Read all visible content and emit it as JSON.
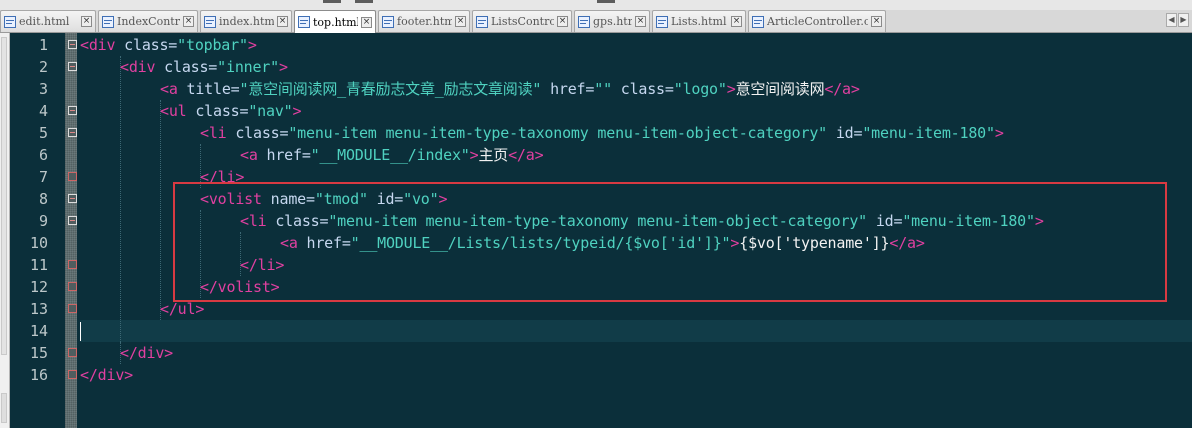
{
  "tabs": [
    {
      "label": "edit.html",
      "active": false
    },
    {
      "label": "IndexController.class.php",
      "active": false
    },
    {
      "label": "index.html",
      "active": false
    },
    {
      "label": "top.html",
      "active": true
    },
    {
      "label": "footer.html",
      "active": false
    },
    {
      "label": "ListsController.class.php",
      "active": false
    },
    {
      "label": "gps.html",
      "active": false
    },
    {
      "label": "Lists.html",
      "active": false
    },
    {
      "label": "ArticleController.class.php",
      "active": false
    }
  ],
  "tab_scroll": {
    "left": "◀",
    "right": "▶"
  },
  "close_glyph": "×",
  "line_numbers": [
    "1",
    "2",
    "3",
    "4",
    "5",
    "6",
    "7",
    "8",
    "9",
    "10",
    "11",
    "12",
    "13",
    "14",
    "15",
    "16"
  ],
  "code_lines": [
    [
      {
        "t": "tag",
        "v": "<div "
      },
      {
        "t": "attr",
        "v": "class="
      },
      {
        "t": "val",
        "v": "\"topbar\""
      },
      {
        "t": "tag",
        "v": ">"
      }
    ],
    [
      {
        "t": "tag",
        "v": "<div "
      },
      {
        "t": "attr",
        "v": "class="
      },
      {
        "t": "val",
        "v": "\"inner\""
      },
      {
        "t": "tag",
        "v": ">"
      }
    ],
    [
      {
        "t": "tag",
        "v": "<a "
      },
      {
        "t": "attr",
        "v": "title="
      },
      {
        "t": "val",
        "v": "\"意空间阅读网_青春励志文章_励志文章阅读\""
      },
      {
        "t": "attr",
        "v": " href="
      },
      {
        "t": "val",
        "v": "\"\""
      },
      {
        "t": "attr",
        "v": " class="
      },
      {
        "t": "val",
        "v": "\"logo\""
      },
      {
        "t": "tag",
        "v": ">"
      },
      {
        "t": "text",
        "v": "意空间阅读网"
      },
      {
        "t": "tag",
        "v": "</a>"
      }
    ],
    [
      {
        "t": "tag",
        "v": "<ul "
      },
      {
        "t": "attr",
        "v": "class="
      },
      {
        "t": "val",
        "v": "\"nav\""
      },
      {
        "t": "tag",
        "v": ">"
      }
    ],
    [
      {
        "t": "tag",
        "v": "<li "
      },
      {
        "t": "attr",
        "v": "class="
      },
      {
        "t": "val",
        "v": "\"menu-item menu-item-type-taxonomy menu-item-object-category\""
      },
      {
        "t": "attr",
        "v": " id="
      },
      {
        "t": "val",
        "v": "\"menu-item-180\""
      },
      {
        "t": "tag",
        "v": ">"
      }
    ],
    [
      {
        "t": "tag",
        "v": "<a "
      },
      {
        "t": "attr",
        "v": "href="
      },
      {
        "t": "val",
        "v": "\"__MODULE__/index\""
      },
      {
        "t": "tag",
        "v": ">"
      },
      {
        "t": "text",
        "v": "主页"
      },
      {
        "t": "tag",
        "v": "</a>"
      }
    ],
    [
      {
        "t": "tag",
        "v": "</li>"
      }
    ],
    [
      {
        "t": "tag",
        "v": "<volist "
      },
      {
        "t": "attr",
        "v": "name="
      },
      {
        "t": "val",
        "v": "\"tmod\""
      },
      {
        "t": "attr",
        "v": " id="
      },
      {
        "t": "val",
        "v": "\"vo\""
      },
      {
        "t": "tag",
        "v": ">"
      }
    ],
    [
      {
        "t": "tag",
        "v": "<li "
      },
      {
        "t": "attr",
        "v": "class="
      },
      {
        "t": "val",
        "v": "\"menu-item menu-item-type-taxonomy menu-item-object-category\""
      },
      {
        "t": "attr",
        "v": " id="
      },
      {
        "t": "val",
        "v": "\"menu-item-180\""
      },
      {
        "t": "tag",
        "v": ">"
      }
    ],
    [
      {
        "t": "tag",
        "v": "<a "
      },
      {
        "t": "attr",
        "v": "href="
      },
      {
        "t": "val",
        "v": "\"__MODULE__/Lists/lists/typeid/{$vo['id']}\""
      },
      {
        "t": "tag",
        "v": ">"
      },
      {
        "t": "text",
        "v": "{$vo['typename']}"
      },
      {
        "t": "tag",
        "v": "</a>"
      }
    ],
    [
      {
        "t": "tag",
        "v": "</li>"
      }
    ],
    [
      {
        "t": "tag",
        "v": "</volist>"
      }
    ],
    [
      {
        "t": "tag",
        "v": "</ul>"
      }
    ],
    [],
    [
      {
        "t": "tag",
        "v": "</div>"
      }
    ],
    [
      {
        "t": "tag",
        "v": "</div>"
      }
    ]
  ],
  "colors": {
    "background": "#0b2f3a",
    "tag": "#e040a0",
    "attribute": "#c6d8f0",
    "string": "#4fd2c0",
    "text": "#f2f2f2",
    "highlight_box": "#d83a42"
  },
  "current_line": 14
}
